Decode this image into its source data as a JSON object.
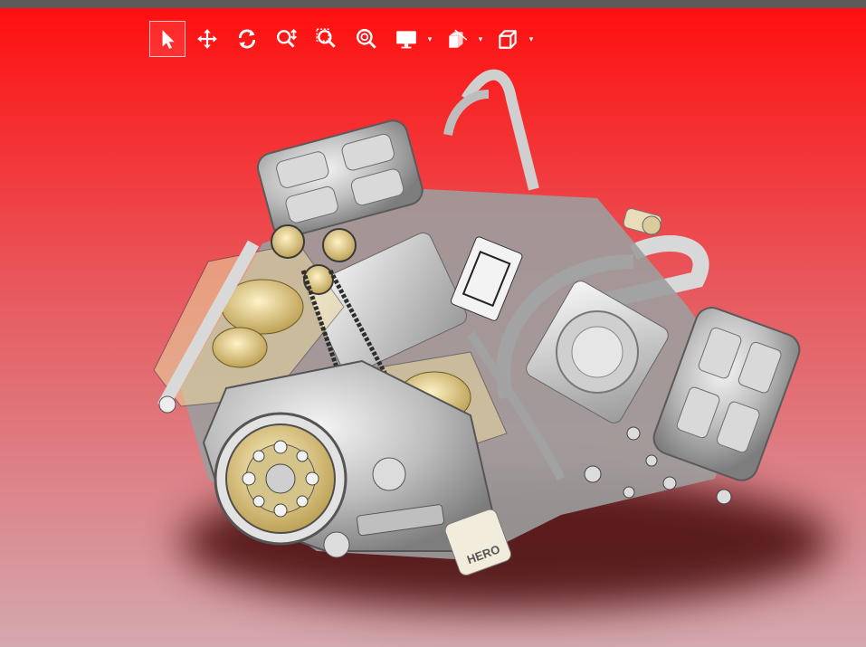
{
  "colors": {
    "top_bar": "#5b5b5b",
    "background_top": "#ff0f0f",
    "background_bottom": "#d3a8ae",
    "toolbar_icon": "#ffffff"
  },
  "toolbar": {
    "tools": [
      {
        "name": "select-tool",
        "icon": "cursor-arrow-icon",
        "active": true
      },
      {
        "name": "pan-tool",
        "icon": "move-arrows-icon"
      },
      {
        "name": "rotate-tool",
        "icon": "rotate-icon"
      },
      {
        "name": "zoom-in-out-tool",
        "icon": "zoom-in-out-icon"
      },
      {
        "name": "zoom-to-area-tool",
        "icon": "zoom-area-icon"
      },
      {
        "name": "zoom-to-fit-tool",
        "icon": "zoom-fit-icon"
      },
      {
        "name": "display-style-dropdown",
        "icon": "monitor-icon",
        "has_dropdown": true
      },
      {
        "name": "section-view-dropdown",
        "icon": "section-view-icon",
        "has_dropdown": true
      },
      {
        "name": "view-orientation-dropdown",
        "icon": "cube-icon",
        "has_dropdown": true
      }
    ]
  },
  "model": {
    "description_icon": "engine-3d-model",
    "crankcase_text": "HERO"
  }
}
